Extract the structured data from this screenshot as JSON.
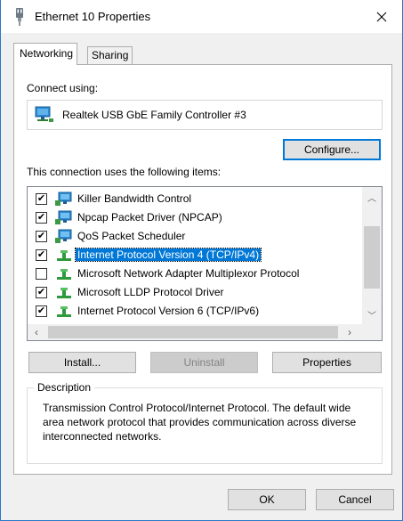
{
  "window": {
    "title": "Ethernet 10 Properties"
  },
  "tabs": [
    {
      "label": "Networking",
      "active": true
    },
    {
      "label": "Sharing",
      "active": false
    }
  ],
  "connect_using": {
    "label": "Connect using:",
    "adapter_name": "Realtek USB GbE Family Controller #3",
    "adapter_icon": "network-adapter-icon"
  },
  "buttons": {
    "configure": "Configure...",
    "install": "Install...",
    "uninstall": "Uninstall",
    "properties": "Properties",
    "ok": "OK",
    "cancel": "Cancel"
  },
  "items_label": "This connection uses the following items:",
  "items": [
    {
      "label": "Killer Bandwidth Control",
      "checked": true,
      "icon": "service-icon"
    },
    {
      "label": "Npcap Packet Driver (NPCAP)",
      "checked": true,
      "icon": "service-icon"
    },
    {
      "label": "QoS Packet Scheduler",
      "checked": true,
      "icon": "service-icon"
    },
    {
      "label": "Internet Protocol Version 4 (TCP/IPv4)",
      "checked": true,
      "selected": true,
      "icon": "protocol-icon"
    },
    {
      "label": "Microsoft Network Adapter Multiplexor Protocol",
      "checked": false,
      "icon": "protocol-icon"
    },
    {
      "label": "Microsoft LLDP Protocol Driver",
      "checked": true,
      "icon": "protocol-icon"
    },
    {
      "label": "Internet Protocol Version 6 (TCP/IPv6)",
      "checked": true,
      "icon": "protocol-icon"
    }
  ],
  "description": {
    "title": "Description",
    "text": "Transmission Control Protocol/Internet Protocol. The default wide area network protocol that provides communication across diverse interconnected networks."
  },
  "colors": {
    "accent": "#0078d7",
    "window_border": "#2b79c7"
  }
}
